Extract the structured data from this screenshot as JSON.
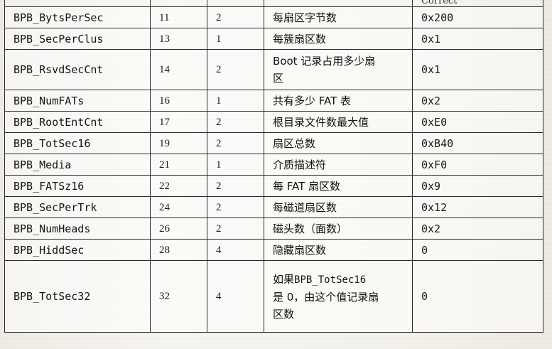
{
  "table": {
    "header": {
      "col5": "Correct"
    },
    "rows": [
      {
        "name": "BPB_BytsPerSec",
        "offset": "11",
        "size": "2",
        "desc": "每扇区字节数",
        "value": "0x200"
      },
      {
        "name": "BPB_SecPerClus",
        "offset": "13",
        "size": "1",
        "desc": "每簇扇区数",
        "value": "0x1"
      },
      {
        "name": "BPB_RsvdSecCnt",
        "offset": "14",
        "size": "2",
        "desc_line1": "Boot 记录占用多少扇",
        "desc_line2": "区",
        "value": "0x1"
      },
      {
        "name": "BPB_NumFATs",
        "offset": "16",
        "size": "1",
        "desc": "共有多少 FAT 表",
        "value": "0x2"
      },
      {
        "name": "BPB_RootEntCnt",
        "offset": "17",
        "size": "2",
        "desc": "根目录文件数最大值",
        "value": "0xE0"
      },
      {
        "name": "BPB_TotSec16",
        "offset": "19",
        "size": "2",
        "desc": "扇区总数",
        "value": "0xB40"
      },
      {
        "name": "BPB_Media",
        "offset": "21",
        "size": "1",
        "desc": "介质描述符",
        "value": "0xF0"
      },
      {
        "name": "BPB_FATSz16",
        "offset": "22",
        "size": "2",
        "desc": "每 FAT 扇区数",
        "value": "0x9"
      },
      {
        "name": "BPB_SecPerTrk",
        "offset": "24",
        "size": "2",
        "desc": "每磁道扇区数",
        "value": "0x12"
      },
      {
        "name": "BPB_NumHeads",
        "offset": "26",
        "size": "2",
        "desc": "磁头数（面数）",
        "value": "0x2"
      },
      {
        "name": "BPB_HiddSec",
        "offset": "28",
        "size": "4",
        "desc": "隐藏扇区数",
        "value": "0"
      },
      {
        "name": "BPB_TotSec32",
        "offset": "32",
        "size": "4",
        "desc_line1_prefix": "如果",
        "desc_line1_code": "BPB_TotSec16",
        "desc_line2": "是 0，由这个值记录扇",
        "desc_line3": "区数",
        "value": "0"
      }
    ]
  }
}
